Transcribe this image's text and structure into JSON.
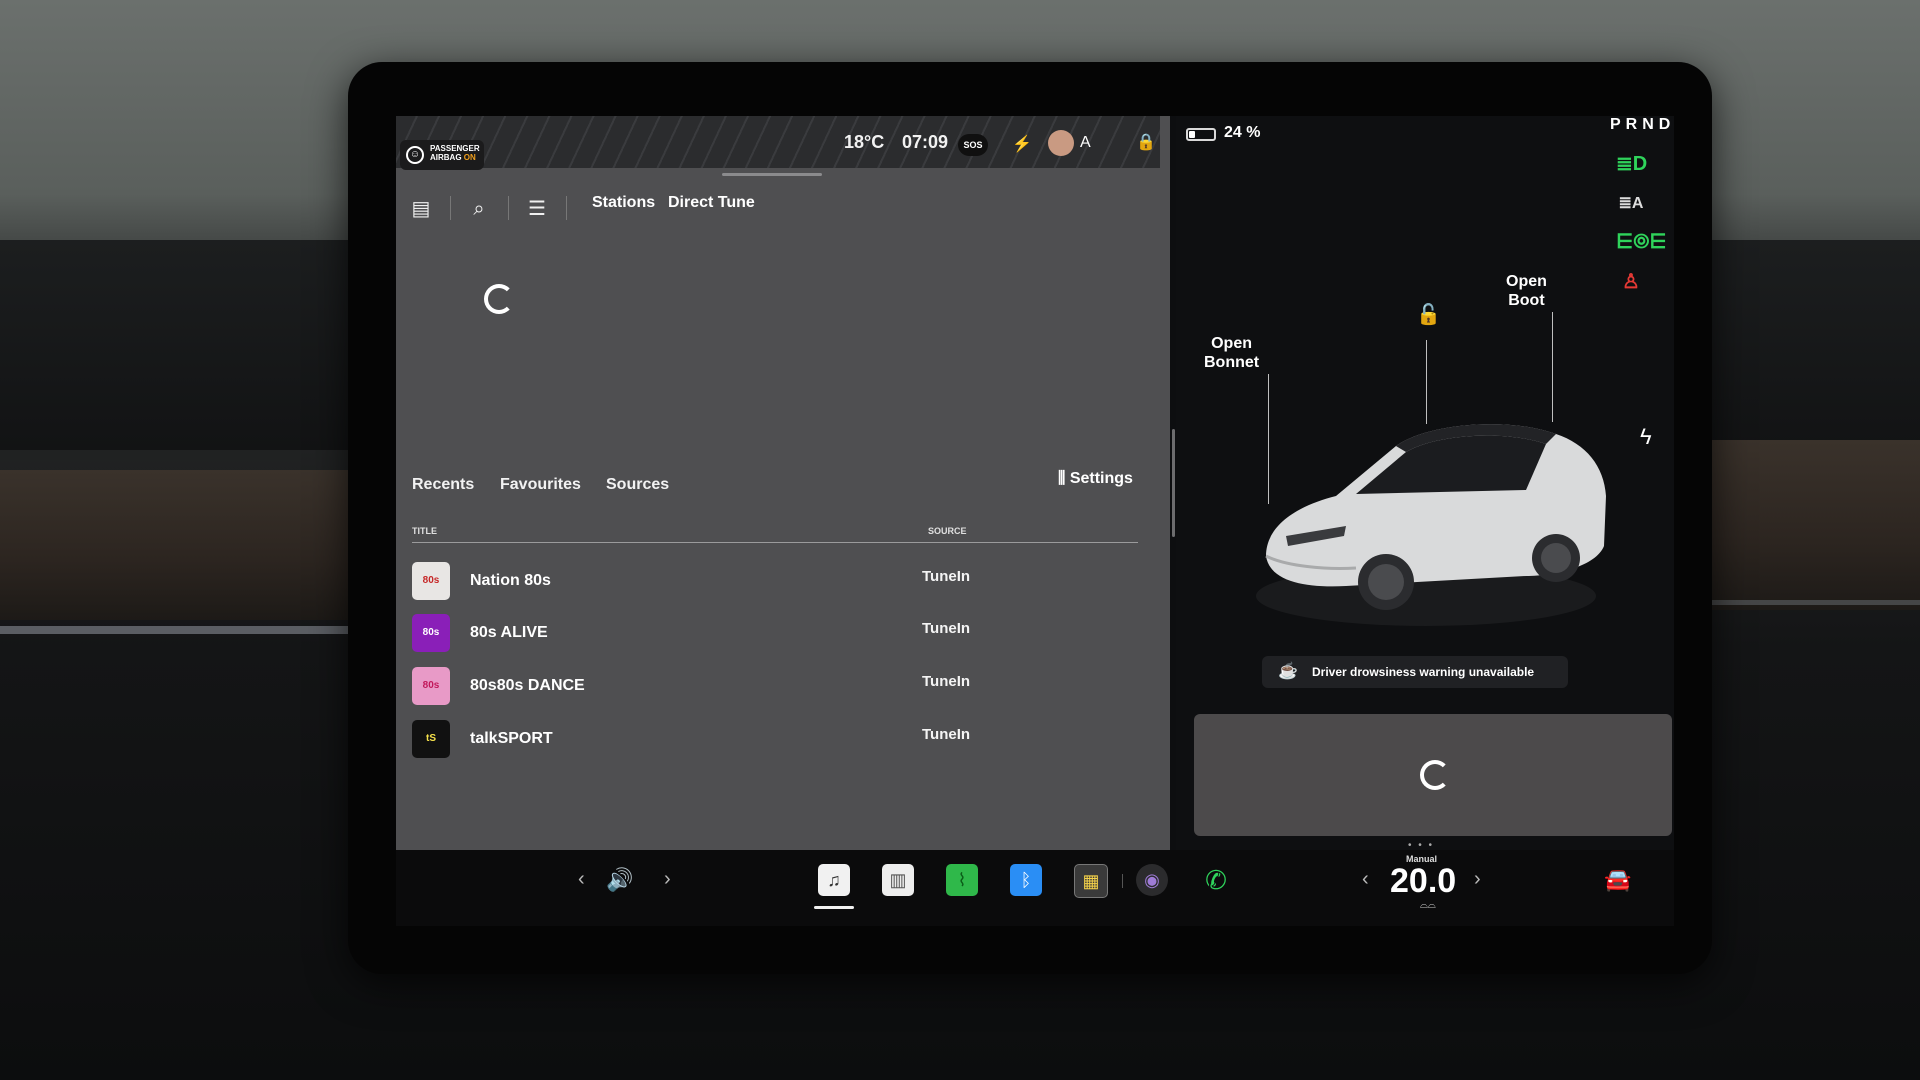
{
  "status_bar": {
    "airbag_line1": "PASSENGER",
    "airbag_line2": "AIRBAG",
    "airbag_state": "ON",
    "temperature": "18°C",
    "time": "07:09",
    "sos": "SOS",
    "profile_letter": "A"
  },
  "toolbar": {
    "stations": "Stations",
    "direct_tune": "Direct Tune"
  },
  "library": {
    "tabs": [
      "Recents",
      "Favourites",
      "Sources"
    ],
    "settings": "Settings",
    "columns": {
      "title": "TITLE",
      "source": "SOURCE"
    },
    "rows": [
      {
        "title": "Nation 80s",
        "source": "TuneIn",
        "thumb_text": "80s",
        "thumb_color": "#e8e6e4"
      },
      {
        "title": "80s ALIVE",
        "source": "TuneIn",
        "thumb_text": "80s",
        "thumb_color": "#8a1fb8"
      },
      {
        "title": "80s80s DANCE",
        "source": "TuneIn",
        "thumb_text": "80s",
        "thumb_color": "#e89ac7"
      },
      {
        "title": "talkSPORT",
        "source": "TuneIn",
        "thumb_text": "tS",
        "thumb_color": "#111111"
      }
    ]
  },
  "vehicle": {
    "battery_percent": 24,
    "battery_text": "24 %",
    "gear": "PRND",
    "open_bonnet": [
      "Open",
      "Bonnet"
    ],
    "open_boot": [
      "Open",
      "Boot"
    ],
    "drowsiness_warning": "Driver drowsiness warning unavailable",
    "lamp_colors": {
      "green": "#2fd35b",
      "red": "#e53935"
    }
  },
  "climate": {
    "mode": "Manual",
    "temperature": "20.0"
  },
  "taskbar_icons": [
    "volume-icon",
    "media-icon",
    "notes-icon",
    "energy-app-icon",
    "bluetooth-icon",
    "toybox-icon",
    "camera-icon",
    "phone-icon",
    "car-icon"
  ]
}
